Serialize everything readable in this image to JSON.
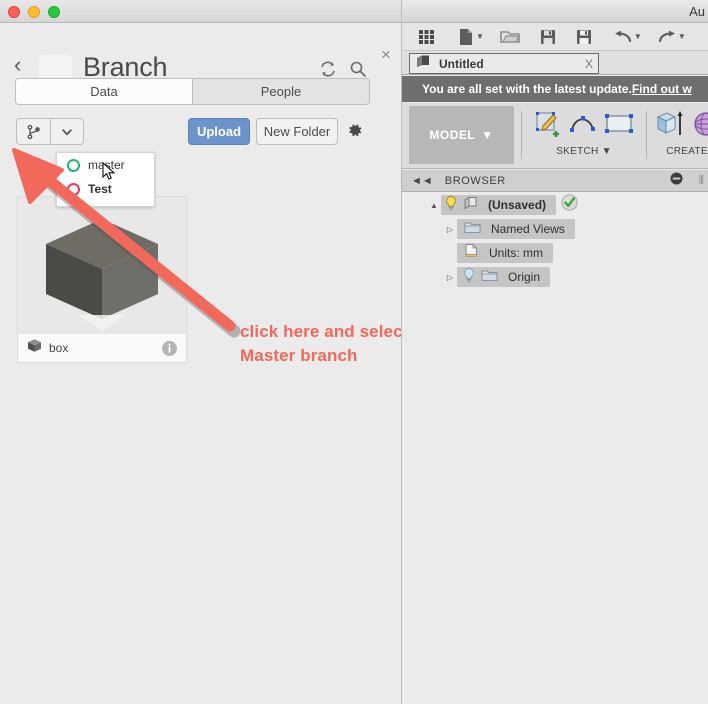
{
  "left_panel": {
    "window_controls": [
      "close",
      "minimize",
      "zoom"
    ],
    "back_label": "‹",
    "title": "Branch",
    "refresh_icon": "refresh-icon",
    "search_icon": "search-icon",
    "close_icon": "×",
    "tabs": [
      {
        "label": "Data",
        "active": true
      },
      {
        "label": "People",
        "active": false
      }
    ],
    "toolbar": {
      "branch_icon": "branch-icon",
      "branch_dropdown_icon": "chevron-down-icon",
      "upload_label": "Upload",
      "new_folder_label": "New Folder",
      "settings_icon": "gear-icon"
    },
    "branch_dropdown": {
      "items": [
        {
          "label": "master",
          "color": "#22b573",
          "bold": false
        },
        {
          "label": "Test",
          "color": "#e8365e",
          "bold": true
        }
      ]
    },
    "card": {
      "title": "box",
      "thumb_icon": "cube-icon",
      "info_icon": "info-icon"
    },
    "annotation": {
      "line1": "click here and select",
      "line2": "Master branch",
      "color": "#f2685a"
    }
  },
  "right_window": {
    "app_title": "Au",
    "toolbar_items": [
      "grid-icon",
      "new-document-icon",
      "open-folder-icon",
      "save-icon",
      "save-as-icon",
      "undo-icon",
      "redo-icon"
    ],
    "document_tab": {
      "label": "Untitled",
      "icon": "cube-icon",
      "close_icon": "X"
    },
    "notice": {
      "text": "You are all set with the latest update. ",
      "link": "Find out w"
    },
    "ribbon": {
      "workspace_label": "MODEL",
      "workspace_caret": "▼",
      "groups": [
        {
          "label": "SKETCH",
          "caret": "▼",
          "icons": [
            "create-sketch-icon",
            "spline-icon",
            "rectangle-icon"
          ]
        },
        {
          "label": "CREATE",
          "caret": "",
          "icons": [
            "extrude-icon",
            "revolve-icon"
          ]
        }
      ]
    },
    "browser": {
      "collapse_icon": "◄◄",
      "label": "BROWSER",
      "minimize_icon": "minimize-icon",
      "tree": [
        {
          "label": "(Unsaved)",
          "indent": 0,
          "disclosure": "▲",
          "icons": [
            "lightbulb-icon",
            "document-icon"
          ],
          "badge": "green-check-icon"
        },
        {
          "label": "Named Views",
          "indent": 1,
          "disclosure": "▷",
          "icons": [
            "folder-icon"
          ],
          "badge": ""
        },
        {
          "label": "Units: mm",
          "indent": 1,
          "disclosure": "",
          "icons": [
            "units-document-icon"
          ],
          "badge": ""
        },
        {
          "label": "Origin",
          "indent": 1,
          "disclosure": "▷",
          "icons": [
            "lightbulb-icon",
            "folder-icon"
          ],
          "badge": ""
        }
      ]
    }
  }
}
